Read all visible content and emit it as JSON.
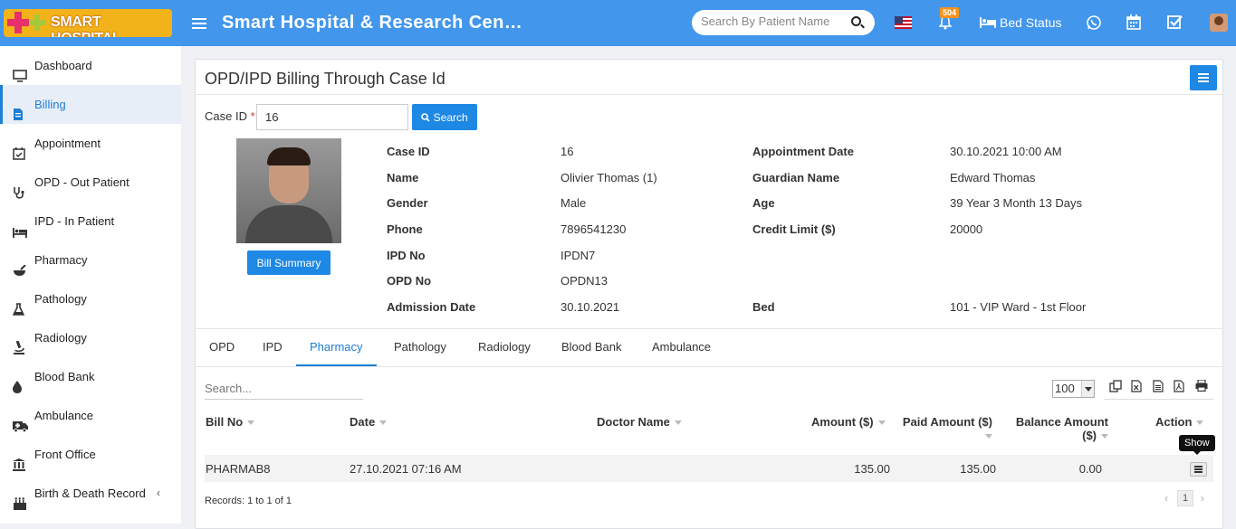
{
  "header": {
    "logo_text": "SMART HOSPITAL",
    "site_title": "Smart Hospital & Research Cen…",
    "search_placeholder": "Search By Patient Name",
    "notification_count": "504",
    "bed_status_label": "Bed Status",
    "icons": [
      "menu-icon",
      "search-icon",
      "us-flag-icon",
      "bell-icon",
      "bed-icon",
      "whatsapp-icon",
      "calendar-icon",
      "task-check-icon",
      "user-avatar"
    ]
  },
  "sidebar": {
    "items": [
      {
        "label": "Dashboard",
        "icon": "monitor-icon"
      },
      {
        "label": "Billing",
        "icon": "document-icon"
      },
      {
        "label": "Appointment",
        "icon": "calendar-check-icon"
      },
      {
        "label": "OPD - Out Patient",
        "icon": "stethoscope-icon"
      },
      {
        "label": "IPD - In Patient",
        "icon": "bed-icon"
      },
      {
        "label": "Pharmacy",
        "icon": "mortar-pestle-icon"
      },
      {
        "label": "Pathology",
        "icon": "flask-icon"
      },
      {
        "label": "Radiology",
        "icon": "microscope-icon"
      },
      {
        "label": "Blood Bank",
        "icon": "droplet-icon"
      },
      {
        "label": "Ambulance",
        "icon": "ambulance-icon"
      },
      {
        "label": "Front Office",
        "icon": "building-icon"
      },
      {
        "label": "Birth & Death Record",
        "icon": "family-icon"
      }
    ],
    "active_index": 1
  },
  "panel": {
    "title": "OPD/IPD Billing Through Case Id",
    "case_id_label": "Case ID",
    "required_mark": "*",
    "case_id_value": "16",
    "search_button": "Search",
    "bill_summary_button": "Bill Summary"
  },
  "patient": {
    "left": [
      {
        "label": "Case ID",
        "value": "16"
      },
      {
        "label": "Name",
        "value": "Olivier Thomas (1)"
      },
      {
        "label": "Gender",
        "value": "Male"
      },
      {
        "label": "Phone",
        "value": "7896541230"
      },
      {
        "label": "IPD No",
        "value": "IPDN7"
      },
      {
        "label": "OPD No",
        "value": "OPDN13"
      },
      {
        "label": "Admission Date",
        "value": "30.10.2021"
      }
    ],
    "right": [
      {
        "label": "Appointment Date",
        "value": "30.10.2021 10:00 AM"
      },
      {
        "label": "Guardian Name",
        "value": "Edward Thomas"
      },
      {
        "label": "Age",
        "value": "39 Year 3 Month 13 Days"
      },
      {
        "label": "Credit Limit ($)",
        "value": "20000"
      },
      {
        "label": "Bed",
        "value": "101 - VIP Ward - 1st Floor"
      }
    ]
  },
  "tabs": [
    "OPD",
    "IPD",
    "Pharmacy",
    "Pathology",
    "Radiology",
    "Blood Bank",
    "Ambulance"
  ],
  "active_tab": "Pharmacy",
  "table": {
    "search_placeholder": "Search...",
    "page_size": "100",
    "export_icons": [
      "copy-icon",
      "excel-icon",
      "csv-icon",
      "pdf-icon",
      "print-icon"
    ],
    "columns": [
      "Bill No",
      "Date",
      "Doctor Name",
      "Amount ($)",
      "Paid Amount ($)",
      "Balance Amount ($)",
      "Action"
    ],
    "balance_header_line1": "Balance Amount",
    "balance_header_line2": "($)",
    "rows": [
      {
        "bill_no": "PHARMAB8",
        "date": "27.10.2021 07:16 AM",
        "doctor": "",
        "amount": "135.00",
        "paid": "135.00",
        "balance": "0.00"
      }
    ],
    "action_tooltip": "Show",
    "records_text": "Records: 1 to 1 of 1",
    "current_page": "1",
    "prev_symbol": "‹",
    "next_symbol": "›"
  },
  "colors": {
    "header": "#4296ec",
    "primary": "#1e88e5",
    "active_text": "#1e7fd4"
  }
}
